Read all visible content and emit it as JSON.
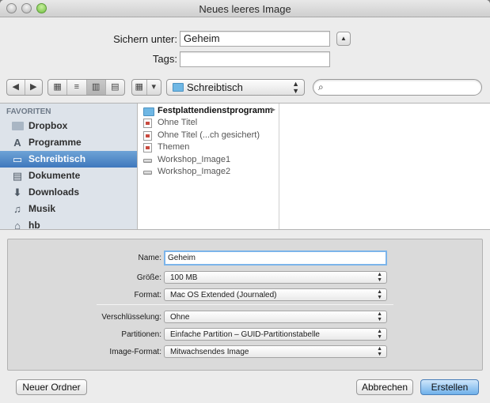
{
  "window": {
    "title": "Neues leeres Image"
  },
  "save": {
    "save_as_label": "Sichern unter:",
    "save_as_value": "Geheim",
    "tags_label": "Tags:",
    "tags_value": ""
  },
  "toolbar": {
    "back_icon": "◀",
    "forward_icon": "▶",
    "view_icons": "▦",
    "view_list": "≡",
    "view_columns": "▥",
    "view_coverflow": "▤",
    "arrange_icon": "▦",
    "arrange_arrow": "▾",
    "location": "Schreibtisch",
    "search_icon": "⌕"
  },
  "sidebar": {
    "header": "FAVORITEN",
    "items": [
      {
        "label": "Dropbox",
        "icon": "folder-icon",
        "selected": false
      },
      {
        "label": "Programme",
        "icon": "applications-icon",
        "selected": false
      },
      {
        "label": "Schreibtisch",
        "icon": "desktop-icon",
        "selected": true
      },
      {
        "label": "Dokumente",
        "icon": "documents-icon",
        "selected": false
      },
      {
        "label": "Downloads",
        "icon": "downloads-icon",
        "selected": false
      },
      {
        "label": "Musik",
        "icon": "music-icon",
        "selected": false
      },
      {
        "label": "hb",
        "icon": "home-icon",
        "selected": false
      }
    ]
  },
  "files": [
    {
      "name": "Festplattendienstprogramm",
      "type": "folder",
      "has_children": true
    },
    {
      "name": "Ohne Titel",
      "type": "document"
    },
    {
      "name": "Ohne Titel (...ch gesichert)",
      "type": "document"
    },
    {
      "name": "Themen",
      "type": "document"
    },
    {
      "name": "Workshop_Image1",
      "type": "disk-image"
    },
    {
      "name": "Workshop_Image2",
      "type": "disk-image"
    }
  ],
  "options": {
    "name_label": "Name:",
    "name_value": "Geheim",
    "size_label": "Größe:",
    "size_value": "100 MB",
    "format_label": "Format:",
    "format_value": "Mac OS Extended (Journaled)",
    "encryption_label": "Verschlüsselung:",
    "encryption_value": "Ohne",
    "partitions_label": "Partitionen:",
    "partitions_value": "Einfache Partition – GUID-Partitionstabelle",
    "image_format_label": "Image-Format:",
    "image_format_value": "Mitwachsendes Image"
  },
  "buttons": {
    "new_folder": "Neuer Ordner",
    "cancel": "Abbrechen",
    "create": "Erstellen"
  },
  "colors": {
    "accent": "#3f78bd",
    "focus_ring": "#7cb4ea",
    "default_button": "#6fb0ea"
  }
}
